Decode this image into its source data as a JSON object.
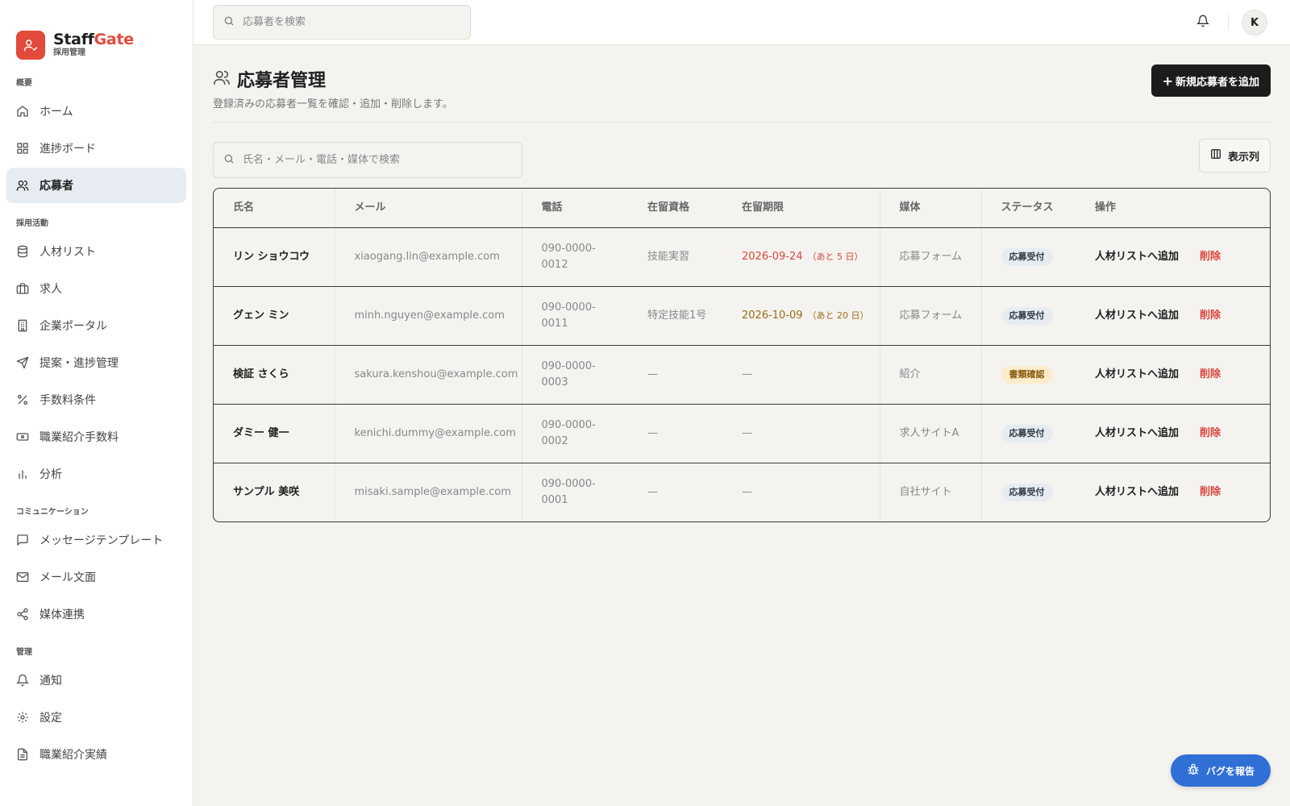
{
  "brand": {
    "name_main": "Staff",
    "name_accent": "Gate",
    "subtitle": "採用管理",
    "icon": "user-check-icon",
    "accent_color": "#e24a3b"
  },
  "sidebar": {
    "sections": [
      {
        "heading": "概要",
        "items": [
          {
            "label": "ホーム",
            "icon": "home-icon"
          },
          {
            "label": "進捗ボード",
            "icon": "grid-icon"
          },
          {
            "label": "応募者",
            "icon": "users-icon",
            "active": true
          }
        ]
      },
      {
        "heading": "採用活動",
        "items": [
          {
            "label": "人材リスト",
            "icon": "database-icon"
          },
          {
            "label": "求人",
            "icon": "briefcase-icon"
          },
          {
            "label": "企業ポータル",
            "icon": "building-icon"
          },
          {
            "label": "提案・進捗管理",
            "icon": "send-icon"
          },
          {
            "label": "手数料条件",
            "icon": "percent-icon"
          },
          {
            "label": "職業紹介手数料",
            "icon": "banknote-icon"
          },
          {
            "label": "分析",
            "icon": "bar-chart-icon"
          }
        ]
      },
      {
        "heading": "コミュニケーション",
        "items": [
          {
            "label": "メッセージテンプレート",
            "icon": "message-icon"
          },
          {
            "label": "メール文面",
            "icon": "mail-icon"
          },
          {
            "label": "媒体連携",
            "icon": "share-icon"
          }
        ]
      },
      {
        "heading": "管理",
        "items": [
          {
            "label": "通知",
            "icon": "bell-icon"
          },
          {
            "label": "設定",
            "icon": "gear-icon"
          },
          {
            "label": "職業紹介実績",
            "icon": "file-text-icon"
          }
        ]
      }
    ]
  },
  "topbar": {
    "search_placeholder": "応募者を検索",
    "avatar_initial": "K"
  },
  "page": {
    "title": "応募者管理",
    "description": "登録済みの応募者一覧を確認・追加・削除します。",
    "add_button": "新規応募者を追加",
    "search_placeholder": "氏名・メール・電話・媒体で検索",
    "columns_button": "表示列"
  },
  "table": {
    "headers": [
      "氏名",
      "メール",
      "電話",
      "在留資格",
      "在留期限",
      "媒体",
      "ステータス",
      "操作"
    ],
    "action_add": "人材リストへ追加",
    "action_delete": "削除",
    "rows": [
      {
        "name": "リン ショウコウ",
        "email": "xiaogang.lin@example.com",
        "phone": "090-0000-0012",
        "visa": "技能実習",
        "expiry": "2026-09-24",
        "remaining": "（あと 5 日）",
        "expiry_tone": "red",
        "source": "応募フォーム",
        "status": "応募受付",
        "status_tone": "blue"
      },
      {
        "name": "グェン ミン",
        "email": "minh.nguyen@example.com",
        "phone": "090-0000-0011",
        "visa": "特定技能1号",
        "expiry": "2026-10-09",
        "remaining": "（あと 20 日）",
        "expiry_tone": "amber",
        "source": "応募フォーム",
        "status": "応募受付",
        "status_tone": "blue"
      },
      {
        "name": "検証 さくら",
        "email": "sakura.kenshou@example.com",
        "phone": "090-0000-0003",
        "visa": "—",
        "expiry": "—",
        "remaining": "",
        "expiry_tone": "none",
        "source": "紹介",
        "status": "書類確認",
        "status_tone": "amber"
      },
      {
        "name": "ダミー 健一",
        "email": "kenichi.dummy@example.com",
        "phone": "090-0000-0002",
        "visa": "—",
        "expiry": "—",
        "remaining": "",
        "expiry_tone": "none",
        "source": "求人サイトA",
        "status": "応募受付",
        "status_tone": "blue"
      },
      {
        "name": "サンプル 美咲",
        "email": "misaki.sample@example.com",
        "phone": "090-0000-0001",
        "visa": "—",
        "expiry": "—",
        "remaining": "",
        "expiry_tone": "none",
        "source": "自社サイト",
        "status": "応募受付",
        "status_tone": "blue"
      }
    ]
  },
  "bug_report": {
    "label": "バグを報告",
    "icon": "bug-icon",
    "color": "#2f6fd6"
  }
}
